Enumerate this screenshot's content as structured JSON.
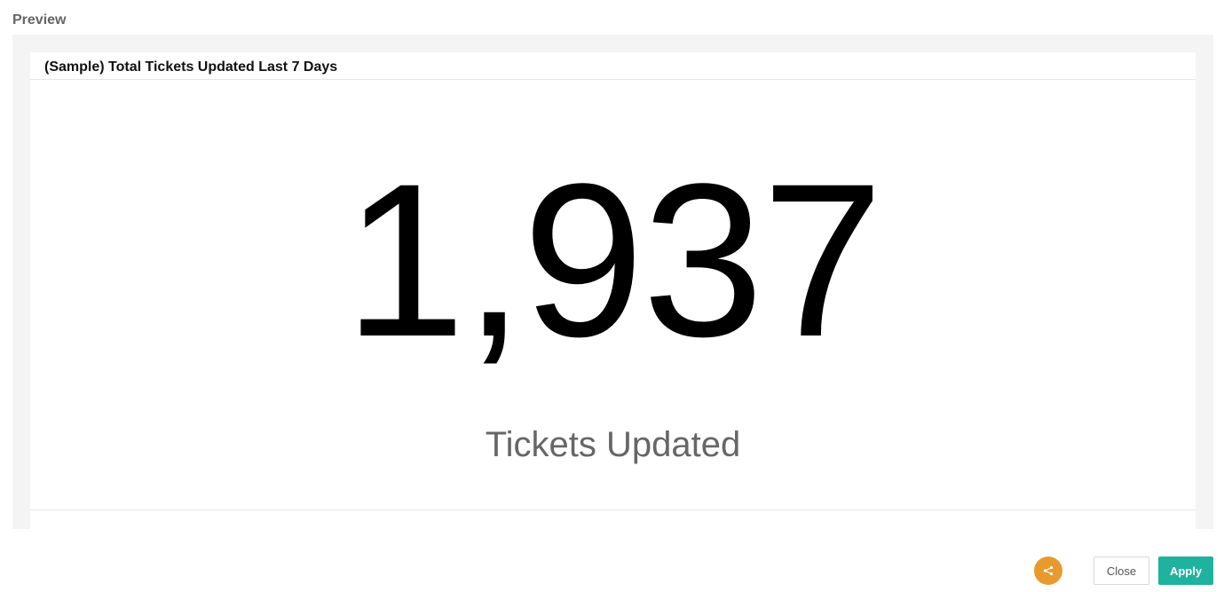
{
  "preview": {
    "heading": "Preview"
  },
  "widget": {
    "title": "(Sample) Total Tickets Updated Last 7 Days",
    "value": "1,937",
    "label": "Tickets Updated"
  },
  "footer": {
    "share_icon": "share-icon",
    "close_label": "Close",
    "apply_label": "Apply"
  },
  "colors": {
    "share_button": "#e89a2c",
    "apply_button": "#1fb29e",
    "preview_background": "#f4f4f4"
  }
}
